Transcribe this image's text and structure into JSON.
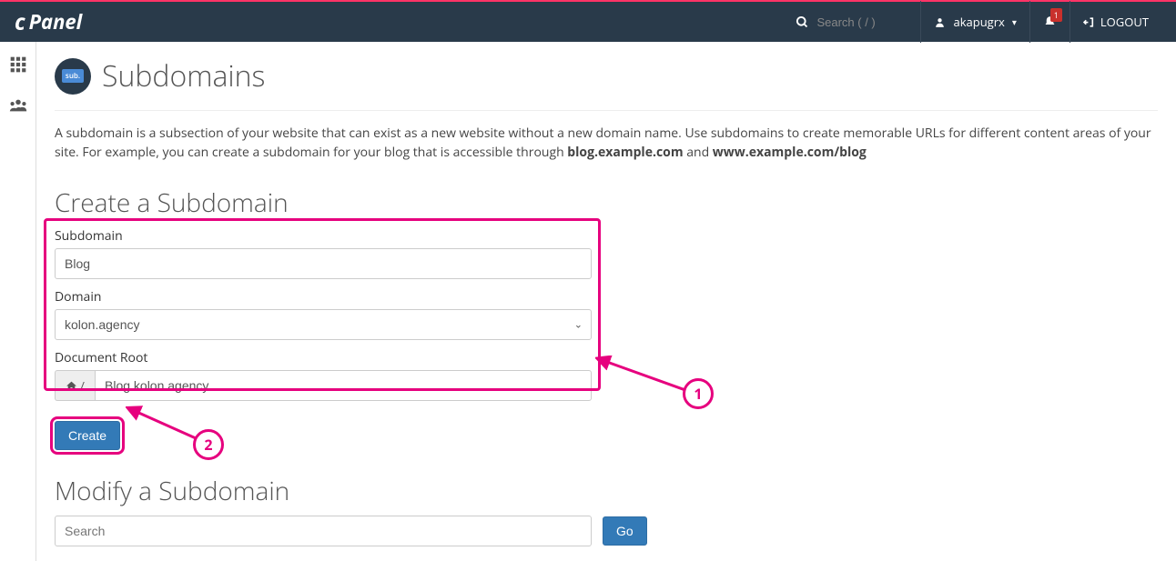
{
  "header": {
    "logo_text": "cPanel",
    "search_placeholder": "Search ( / )",
    "username": "akapugrx",
    "notification_count": "1",
    "logout_label": "LOGOUT"
  },
  "page": {
    "title": "Subdomains",
    "icon_badge": "sub.",
    "intro_pre": "A subdomain is a subsection of your website that can exist as a new website without a new domain name. Use subdomains to create memorable URLs for different content areas of your site. For example, you can create a subdomain for your blog that is accessible through ",
    "intro_bold1": "blog.example.com",
    "intro_mid": " and ",
    "intro_bold2": "www.example.com/blog"
  },
  "create": {
    "heading": "Create a Subdomain",
    "subdomain_label": "Subdomain",
    "subdomain_value": "Blog",
    "domain_label": "Domain",
    "domain_value": "kolon.agency",
    "docroot_label": "Document Root",
    "docroot_prefix": "/",
    "docroot_value": "Blog.kolon.agency",
    "create_button_label": "Create"
  },
  "modify": {
    "heading": "Modify a Subdomain",
    "search_placeholder": "Search",
    "go_button_label": "Go"
  },
  "annotations": {
    "callout1": "1",
    "callout2": "2"
  }
}
